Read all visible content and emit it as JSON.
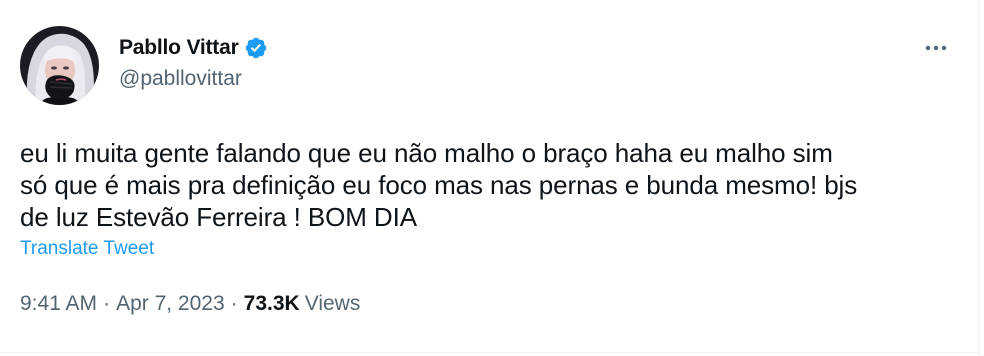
{
  "author": {
    "display_name": "Pabllo Vittar",
    "handle": "@pabllovittar",
    "verified": true,
    "verified_color": "#1d9bf0"
  },
  "tweet": {
    "lines": [
      "eu li muita gente falando que eu não malho o braço haha eu malho sim",
      "só que é mais pra definição eu foco mas nas pernas e bunda mesmo! bjs",
      "de luz Estevão Ferreira ! BOM DIA"
    ],
    "translate_label": "Translate Tweet"
  },
  "meta": {
    "time": "9:41 AM",
    "separator": "·",
    "date": "Apr 7, 2023",
    "views_count": "73.3K",
    "views_label": "Views"
  },
  "icons": {
    "more": "more-horizontal-icon",
    "verified": "verified-badge-icon"
  },
  "colors": {
    "accent": "#1d9bf0",
    "text": "#0f1419",
    "secondary": "#536471"
  }
}
